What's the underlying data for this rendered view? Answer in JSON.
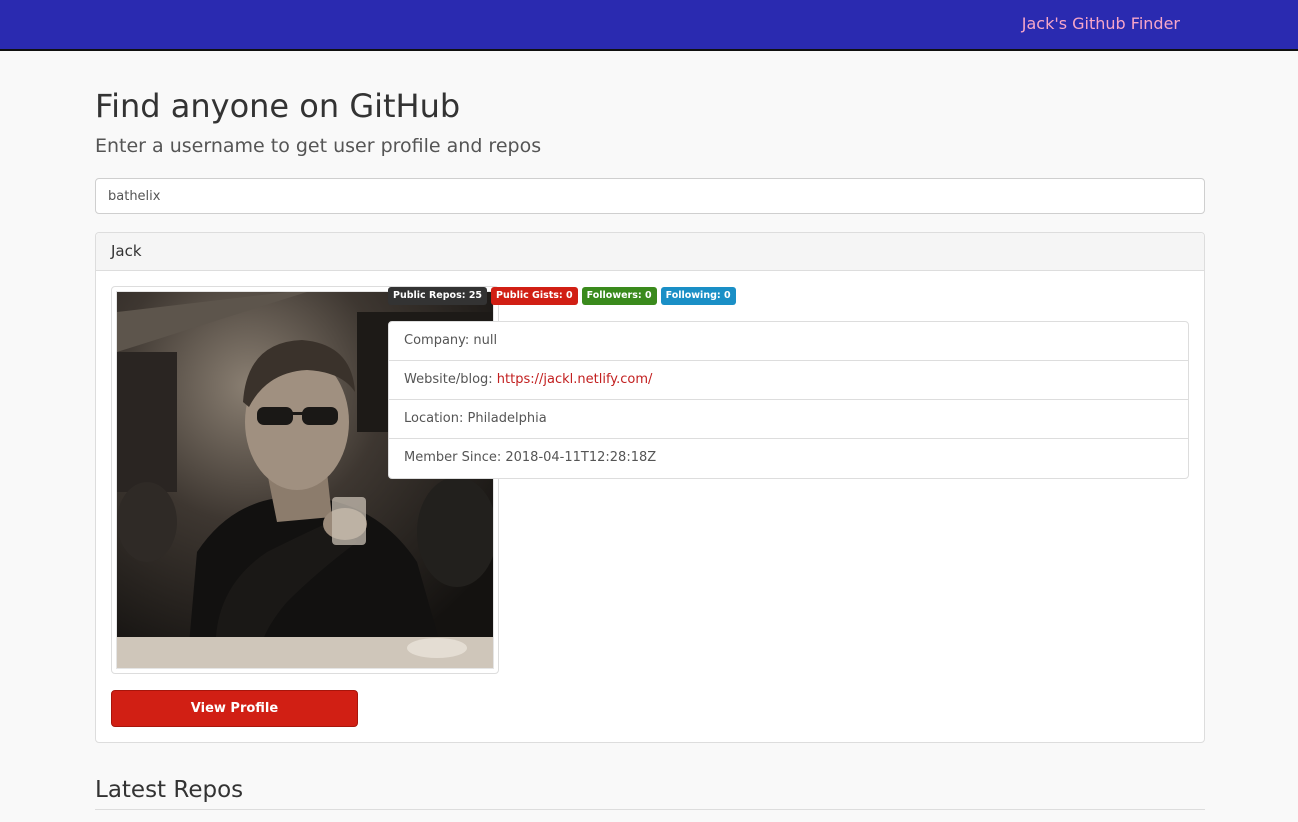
{
  "navbar": {
    "brand": "Jack's Github Finder",
    "brand_color": "#f7a6c8",
    "background": "#2a2ab0"
  },
  "header": {
    "title": "Find anyone on GitHub",
    "subtitle": "Enter a username to get user profile and repos"
  },
  "search": {
    "value": "bathelix"
  },
  "profile": {
    "name": "Jack",
    "avatar_icon": "user-photo",
    "badges": [
      {
        "label": "Public Repos: 25",
        "color": "#333333"
      },
      {
        "label": "Public Gists: 0",
        "color": "#d11f14"
      },
      {
        "label": "Followers: 0",
        "color": "#3a8a1c"
      },
      {
        "label": "Following: 0",
        "color": "#1a8fc6"
      }
    ],
    "info": {
      "company": "Company: null",
      "website_label": "Website/blog: ",
      "website_url": "https://jackl.netlify.com/",
      "location": "Location: Philadelphia",
      "member_since": "Member Since: 2018-04-11T12:28:18Z"
    },
    "view_profile_label": "View Profile",
    "accent": "#d11f14"
  },
  "repos": {
    "heading": "Latest Repos"
  }
}
